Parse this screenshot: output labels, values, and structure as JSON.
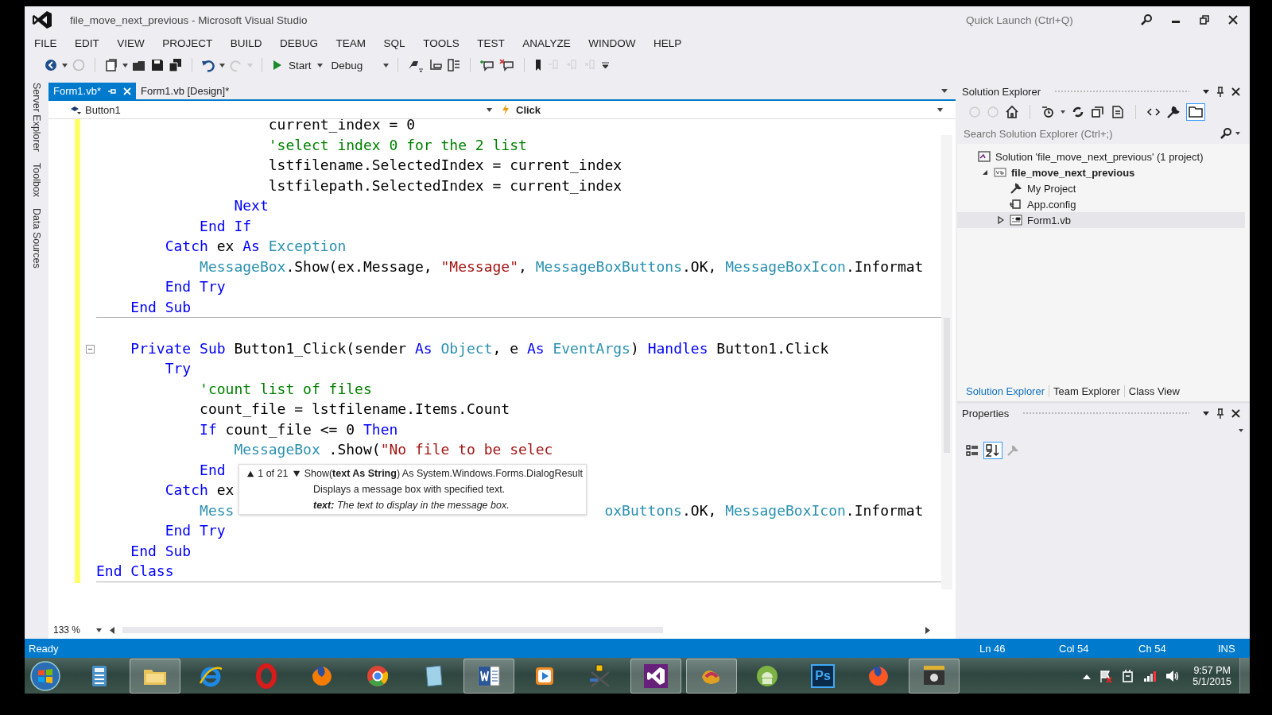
{
  "window": {
    "title": "file_move_next_previous - Microsoft Visual Studio",
    "quick_launch": {
      "placeholder": "Quick Launch (Ctrl+Q)"
    }
  },
  "menu": [
    "FILE",
    "EDIT",
    "VIEW",
    "PROJECT",
    "BUILD",
    "DEBUG",
    "TEAM",
    "SQL",
    "TOOLS",
    "TEST",
    "ANALYZE",
    "WINDOW",
    "HELP"
  ],
  "toolbar": {
    "start": "Start",
    "configuration": "Debug"
  },
  "side_tabs": [
    "Server Explorer",
    "Toolbox",
    "Data Sources"
  ],
  "editor": {
    "tabs": [
      {
        "label": "Form1.vb*",
        "selected": true
      },
      {
        "label": "Form1.vb [Design]*",
        "selected": false
      }
    ],
    "nav": {
      "object": "Button1",
      "member": "Click"
    },
    "blocks": [
      {
        "lines": [
          {
            "kind": "code",
            "tokens": [
              {
                "text": "                    current_index = 0",
                "kind": "plain"
              }
            ]
          },
          {
            "kind": "code",
            "tokens": [
              {
                "text": "                    'select index 0 for the 2 list",
                "kind": "comment"
              }
            ]
          },
          {
            "kind": "code",
            "tokens": [
              {
                "text": "                    lstfilename.SelectedIndex = current_index",
                "kind": "plain"
              }
            ]
          },
          {
            "kind": "code",
            "tokens": [
              {
                "text": "                    lstfilepath.SelectedIndex = current_index",
                "kind": "plain"
              }
            ]
          },
          {
            "kind": "code",
            "tokens": [
              {
                "text": "                Next",
                "kind": "keyword"
              }
            ]
          },
          {
            "kind": "code",
            "tokens": [
              {
                "text": "            End If",
                "kind": "keyword"
              }
            ]
          },
          {
            "kind": "code",
            "tokens": [
              {
                "text": "        Catch",
                "kind": "keyword"
              },
              {
                "text": " ex ",
                "kind": "plain"
              },
              {
                "text": "As",
                "kind": "keyword"
              },
              {
                "text": " Exception",
                "kind": "type"
              }
            ]
          },
          {
            "kind": "code",
            "tokens": [
              {
                "text": "            MessageBox",
                "kind": "type"
              },
              {
                "text": ".Show(ex.Message, ",
                "kind": "plain"
              },
              {
                "text": "\"Message\"",
                "kind": "string"
              },
              {
                "text": ", ",
                "kind": "plain"
              },
              {
                "text": "MessageBoxButtons",
                "kind": "type"
              },
              {
                "text": ".OK, ",
                "kind": "plain"
              },
              {
                "text": "MessageBoxIcon",
                "kind": "type"
              },
              {
                "text": ".Informat",
                "kind": "plain"
              }
            ]
          },
          {
            "kind": "code",
            "tokens": [
              {
                "text": "        End Try",
                "kind": "keyword"
              }
            ]
          },
          {
            "kind": "code",
            "tokens": [
              {
                "text": "    End Sub",
                "kind": "keyword"
              }
            ]
          }
        ]
      },
      {
        "lines": [
          {
            "kind": "blank"
          },
          {
            "kind": "declaration",
            "tokens": [
              {
                "text": "    Private Sub",
                "kind": "keyword"
              },
              {
                "text": " Button1_Click(sender ",
                "kind": "plain"
              },
              {
                "text": "As",
                "kind": "keyword"
              },
              {
                "text": " Object",
                "kind": "type"
              },
              {
                "text": ", e ",
                "kind": "plain"
              },
              {
                "text": "As",
                "kind": "keyword"
              },
              {
                "text": " EventArgs",
                "kind": "type"
              },
              {
                "text": ") ",
                "kind": "plain"
              },
              {
                "text": "Handles",
                "kind": "keyword"
              },
              {
                "text": " Button1.Click",
                "kind": "plain"
              }
            ]
          },
          {
            "kind": "code",
            "tokens": [
              {
                "text": "        Try",
                "kind": "keyword"
              }
            ]
          },
          {
            "kind": "code",
            "tokens": [
              {
                "text": "            'count list of files",
                "kind": "comment"
              }
            ]
          },
          {
            "kind": "code",
            "tokens": [
              {
                "text": "            count_file = lstfilename.Items.Count",
                "kind": "plain"
              }
            ]
          },
          {
            "kind": "code",
            "tokens": [
              {
                "text": "            If",
                "kind": "keyword"
              },
              {
                "text": " count_file <= 0 ",
                "kind": "plain"
              },
              {
                "text": "Then",
                "kind": "keyword"
              }
            ]
          },
          {
            "kind": "code",
            "tokens": [
              {
                "text": "                MessageBox",
                "kind": "type"
              },
              {
                "text": " .Show(",
                "kind": "plain"
              },
              {
                "text": "\"No file to be selec",
                "kind": "string"
              }
            ]
          },
          {
            "kind": "code",
            "tokens": [
              {
                "text": "            End",
                "kind": "keyword"
              }
            ]
          },
          {
            "kind": "code",
            "tokens": [
              {
                "text": "        Catch",
                "kind": "keyword"
              },
              {
                "text": " ex",
                "kind": "plain"
              }
            ]
          },
          {
            "kind": "partial",
            "tokens": [
              {
                "text": "            Mess",
                "kind": "type"
              },
              {
                "text": "                                           oxButtons",
                "kind": "type"
              },
              {
                "text": ".OK, ",
                "kind": "plain"
              },
              {
                "text": "MessageBoxIcon",
                "kind": "type"
              },
              {
                "text": ".Informat",
                "kind": "plain"
              }
            ]
          },
          {
            "kind": "code",
            "tokens": [
              {
                "text": "        End Try",
                "kind": "keyword"
              }
            ]
          },
          {
            "kind": "code",
            "tokens": [
              {
                "text": "    End Sub",
                "kind": "keyword"
              }
            ]
          },
          {
            "kind": "code",
            "tokens": [
              {
                "text": "End Class",
                "kind": "keyword"
              }
            ]
          }
        ]
      }
    ],
    "tooltip": {
      "counter": "1 of 21",
      "signature": "Show(**text As String**) As System.Windows.Forms.DialogResult",
      "description": "Displays a message box with specified text.",
      "parameter": "**text:** The text to display in the message box."
    },
    "zoom": "133 %"
  },
  "solution_explorer": {
    "title": "Solution Explorer",
    "search": {
      "placeholder": "Search Solution Explorer (Ctrl+;)"
    },
    "tree": [
      {
        "label": "Solution 'file_move_next_previous' (1 project)",
        "kind": "solution",
        "selected": false,
        "children": [
          {
            "label": "file_move_next_previous",
            "kind": "project",
            "selected": false,
            "expanded": true,
            "children": [
              {
                "label": "My Project",
                "kind": "properties",
                "selected": false
              },
              {
                "label": "App.config",
                "kind": "config",
                "selected": false
              },
              {
                "label": "Form1.vb",
                "kind": "form",
                "selected": true,
                "expanded": false
              }
            ]
          }
        ]
      }
    ]
  },
  "panel_tabs": [
    {
      "label": "Solution Explorer",
      "selected": true
    },
    {
      "label": "Team Explorer",
      "selected": false
    },
    {
      "label": "Class View",
      "selected": false
    }
  ],
  "properties": {
    "title": "Properties"
  },
  "status_bar": {
    "state": "Ready",
    "line": "Ln 46",
    "column": "Col 54",
    "character": "Ch 54",
    "mode": "INS"
  },
  "taskbar": {
    "apps": [
      {
        "kind": "calculator",
        "active": false
      },
      {
        "kind": "folder",
        "active": true
      },
      {
        "kind": "ie",
        "active": false
      },
      {
        "kind": "opera",
        "active": false
      },
      {
        "kind": "firefox",
        "active": false
      },
      {
        "kind": "chrome",
        "active": false
      },
      {
        "kind": "notes",
        "active": false
      },
      {
        "kind": "word",
        "active": true
      },
      {
        "kind": "media",
        "active": false
      },
      {
        "kind": "tools",
        "active": false
      },
      {
        "kind": "studio",
        "active": true
      },
      {
        "kind": "blend",
        "active": true
      },
      {
        "kind": "android",
        "active": false
      },
      {
        "kind": "photoshop",
        "active": false,
        "label": "Ps"
      },
      {
        "kind": "flame",
        "active": false
      },
      {
        "kind": "camera",
        "active": true
      }
    ],
    "time": "9:57 PM",
    "date": "5/1/2015"
  }
}
